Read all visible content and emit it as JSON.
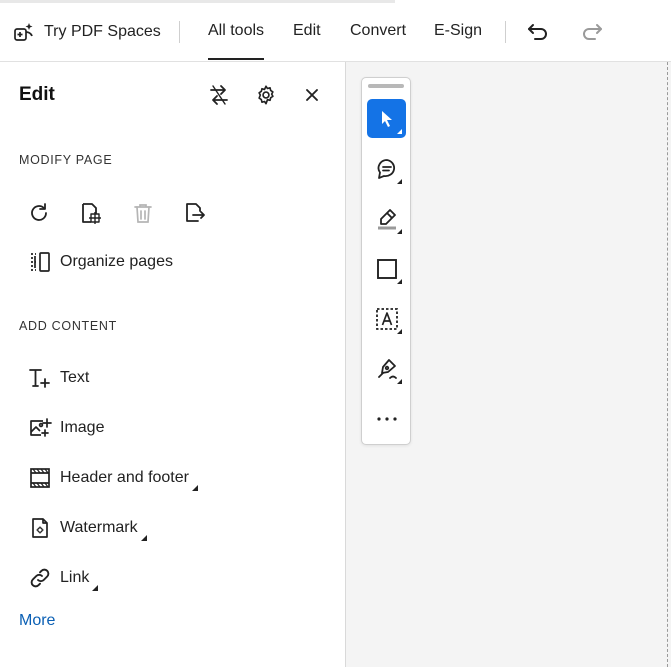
{
  "toolbar": {
    "spaces_label": "Try PDF Spaces",
    "tabs": [
      {
        "label": "All tools",
        "active": true
      },
      {
        "label": "Edit",
        "active": false
      },
      {
        "label": "Convert",
        "active": false
      },
      {
        "label": "E-Sign",
        "active": false
      }
    ],
    "undo_icon": "undo-icon",
    "redo_icon": "redo-icon"
  },
  "panel": {
    "title": "Edit",
    "header_icons": [
      "swap-icon",
      "gear-icon",
      "close-icon"
    ],
    "modify_section": {
      "heading": "MODIFY PAGE",
      "icons": [
        "rotate-icon",
        "crop-icon",
        "trash-icon",
        "export-page-icon"
      ],
      "organize_label": "Organize pages"
    },
    "add_section": {
      "heading": "ADD CONTENT",
      "items": [
        {
          "label": "Text",
          "icon": "add-text-icon",
          "has_menu": false
        },
        {
          "label": "Image",
          "icon": "add-image-icon",
          "has_menu": false
        },
        {
          "label": "Header and footer",
          "icon": "header-footer-icon",
          "has_menu": true
        },
        {
          "label": "Watermark",
          "icon": "watermark-icon",
          "has_menu": true
        },
        {
          "label": "Link",
          "icon": "link-icon",
          "has_menu": true
        }
      ]
    },
    "more_label": "More"
  },
  "quick_tools": {
    "items": [
      "select-pointer-icon",
      "comment-icon",
      "highlight-icon",
      "rectangle-icon",
      "text-box-icon",
      "draw-icon",
      "more-icon"
    ],
    "selected": "select-pointer-icon"
  },
  "colors": {
    "accent": "#1473e6",
    "link": "#0a5fb4",
    "doc_bg": "#f4f4f4"
  }
}
